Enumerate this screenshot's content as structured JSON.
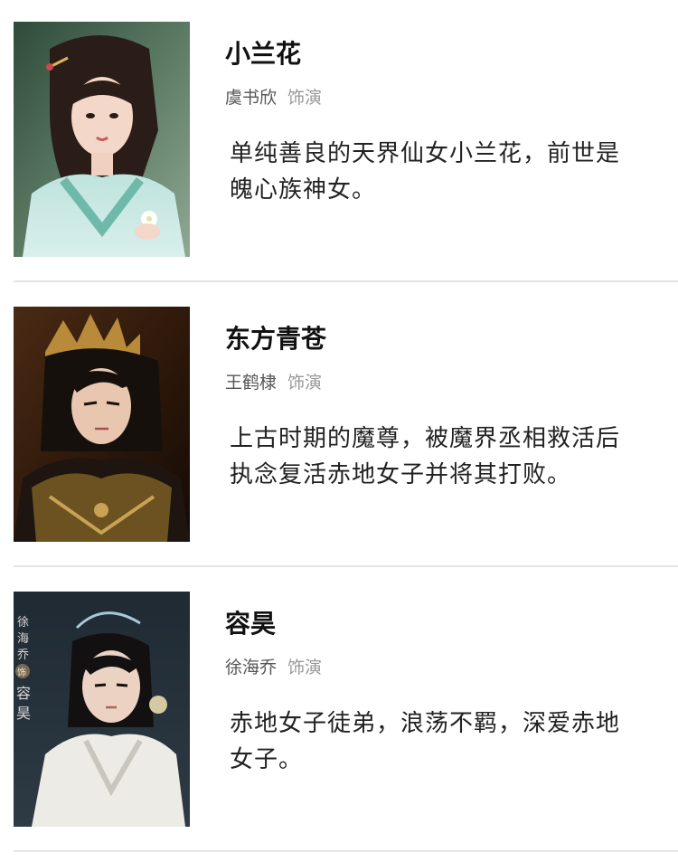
{
  "characters": [
    {
      "name": "小兰花",
      "actor": "虞书欣",
      "role_suffix": "饰演",
      "description": "单纯善良的天界仙女小兰花，前世是魄心族神女。"
    },
    {
      "name": "东方青苍",
      "actor": "王鹤棣",
      "role_suffix": "饰演",
      "description": "上古时期的魔尊，被魔界丞相救活后执念复活赤地女子并将其打败。"
    },
    {
      "name": "容昊",
      "actor": "徐海乔",
      "role_suffix": "饰演",
      "description": "赤地女子徒弟，浪荡不羁，深爱赤地女子。",
      "poster_text": [
        "徐",
        "海",
        "乔",
        "饰",
        "容",
        "昊"
      ]
    }
  ],
  "colors": {
    "name": "#111111",
    "actor": "#555555",
    "role_suffix": "#999999",
    "description": "#222222",
    "divider": "#e4e4e4"
  }
}
